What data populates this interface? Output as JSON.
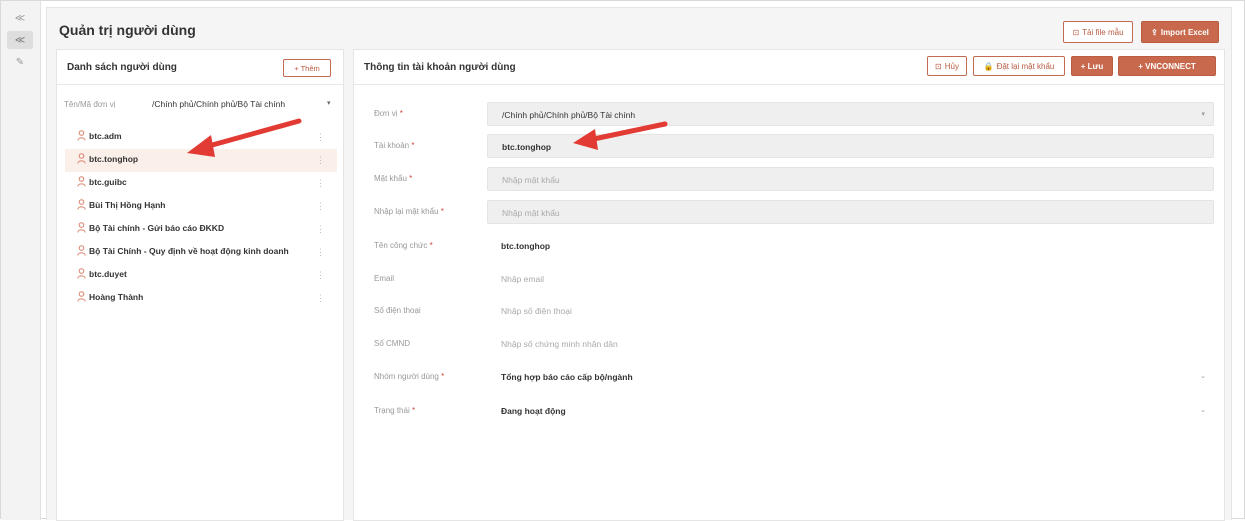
{
  "page": {
    "title": "Quản trị người dùng"
  },
  "header_buttons": {
    "template": "Tải file mẫu",
    "import": "Import Excel"
  },
  "left_panel": {
    "title": "Danh sách người dùng",
    "add_button": "+ Thêm",
    "unit_label": "Tên/Mã đơn vị",
    "unit_value": "/Chính phủ/Chính phủ/Bộ Tài chính",
    "users": [
      {
        "name": "btc.adm",
        "selected": false
      },
      {
        "name": "btc.tonghop",
        "selected": true
      },
      {
        "name": "btc.guibc",
        "selected": false
      },
      {
        "name": "Bùi Thị Hồng Hạnh",
        "selected": false
      },
      {
        "name": "Bộ Tài chính - Gửi báo cáo ĐKKD",
        "selected": false
      },
      {
        "name": "Bộ Tài Chính - Quy định về hoạt động kinh doanh",
        "selected": false
      },
      {
        "name": "btc.duyet",
        "selected": false
      },
      {
        "name": "Hoàng Thành",
        "selected": false
      }
    ]
  },
  "right_panel": {
    "title": "Thông tin tài khoản người dùng",
    "buttons": {
      "cancel": "Hủy",
      "reset_password": "Đặt lại mật khẩu",
      "save": "+ Lưu",
      "vnconnect": "+ VNCONNECT"
    },
    "fields": {
      "unit": {
        "label": "Đơn vị",
        "required": "*",
        "value": "/Chính phủ/Chính phủ/Bộ Tài chính"
      },
      "account": {
        "label": "Tài khoản",
        "required": "*",
        "value": "btc.tonghop"
      },
      "password": {
        "label": "Mật khẩu",
        "required": "*",
        "placeholder": "Nhập mật khẩu"
      },
      "confirm_password": {
        "label": "Nhập lại mật khẩu",
        "required": "*",
        "placeholder": "Nhập mật khẩu"
      },
      "fullname": {
        "label": "Tên công chức",
        "required": "*",
        "value": "btc.tonghop"
      },
      "email": {
        "label": "Email",
        "placeholder": "Nhập email"
      },
      "phone": {
        "label": "Số điện thoại",
        "placeholder": "Nhập số điện thoại"
      },
      "id_number": {
        "label": "Số CMND",
        "placeholder": "Nhập số chứng minh nhân dân"
      },
      "group": {
        "label": "Nhóm người dùng",
        "required": "*",
        "value": "Tổng hợp báo cáo cấp bộ/ngành"
      },
      "status": {
        "label": "Trạng thái",
        "required": "*",
        "value": "Đang hoạt động"
      }
    }
  },
  "icons": {
    "user": "user-icon",
    "collapse": "double-chevron-left-icon",
    "edit": "edit-icon",
    "lock": "lock-icon",
    "upload": "upload-icon",
    "clear": "clear-icon"
  },
  "colors": {
    "accent": "#c8694d",
    "annotation_arrow": "#e23b34",
    "selected_row": "#fbefea"
  }
}
